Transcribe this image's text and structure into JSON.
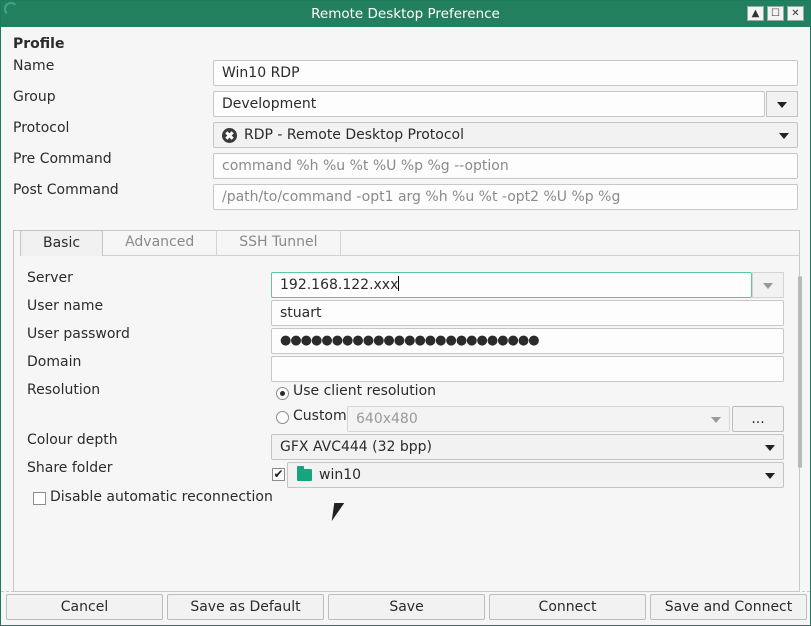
{
  "window": {
    "title": "Remote Desktop Preference",
    "controls": [
      "up-arrow-icon",
      "maximize-icon",
      "close-icon"
    ]
  },
  "profile": {
    "section_label": "Profile",
    "name_label": "Name",
    "name_value": "Win10 RDP",
    "group_label": "Group",
    "group_value": "Development",
    "protocol_label": "Protocol",
    "protocol_value": "RDP - Remote Desktop Protocol",
    "pre_command_label": "Pre Command",
    "pre_command_placeholder": "command %h %u %t %U %p %g --option",
    "post_command_label": "Post Command",
    "post_command_placeholder": "/path/to/command -opt1 arg %h %u %t -opt2 %U %p %g"
  },
  "tabs": [
    {
      "label": "Basic",
      "active": true
    },
    {
      "label": "Advanced",
      "active": false
    },
    {
      "label": "SSH Tunnel",
      "active": false
    }
  ],
  "basic": {
    "server_label": "Server",
    "server_value": "192.168.122.xxx",
    "username_label": "User name",
    "username_value": "stuart",
    "password_label": "User password",
    "password_value": "●●●●●●●●●●●●●●●●●●●●●●●●●",
    "domain_label": "Domain",
    "domain_value": "",
    "resolution_label": "Resolution",
    "use_client_resolution": "Use client resolution",
    "custom_label": "Custom",
    "custom_resolution": "640x480",
    "custom_button": "...",
    "colour_depth_label": "Colour depth",
    "colour_depth_value": "GFX AVC444 (32 bpp)",
    "share_folder_label": "Share folder",
    "share_folder_value": "win10",
    "share_folder_checked": true,
    "disable_reconnect_label": "Disable automatic reconnection",
    "disable_reconnect_checked": false
  },
  "buttons": {
    "cancel": "Cancel",
    "save_default": "Save as Default",
    "save": "Save",
    "connect": "Connect",
    "save_connect": "Save and Connect"
  },
  "colors": {
    "titlebar": "#23805f",
    "focus_border": "#5ec6a0",
    "folder": "#19a37f"
  }
}
